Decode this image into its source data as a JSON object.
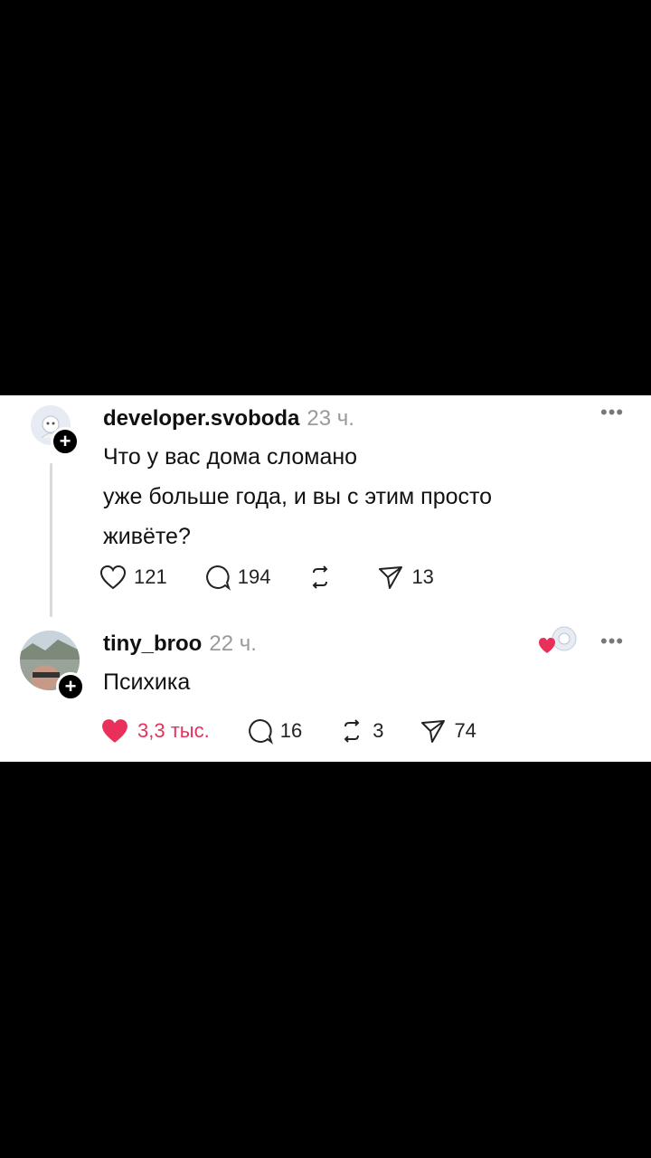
{
  "posts": [
    {
      "username": "developer.svoboda",
      "time": "23 ч.",
      "text_lines": [
        "Что у вас дома сломано",
        "уже больше года, и вы с этим просто",
        "живёте?"
      ],
      "likes": "121",
      "comments": "194",
      "reposts": "",
      "shares": "13",
      "liked": false
    },
    {
      "username": "tiny_broo",
      "time": "22 ч.",
      "text_lines": [
        "Психика"
      ],
      "likes": "3,3 тыс.",
      "comments": "16",
      "reposts": "3",
      "shares": "74",
      "liked": true
    }
  ],
  "colors": {
    "like_active": "#e8305a",
    "muted": "#9a9a9a",
    "text": "#111111"
  },
  "icons": [
    "heart-icon",
    "comment-icon",
    "repost-icon",
    "share-icon",
    "more-icon",
    "follow-plus-icon"
  ]
}
